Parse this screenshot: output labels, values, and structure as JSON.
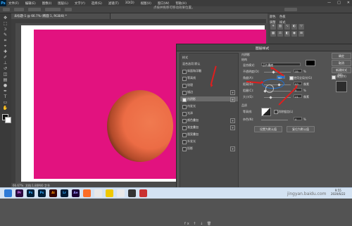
{
  "app": {
    "logo": "Ps",
    "window_controls": [
      "—",
      "□",
      "✕"
    ]
  },
  "menubar": {
    "items": [
      "文件(F)",
      "编辑(E)",
      "图像(I)",
      "图层(L)",
      "文字(Y)",
      "选择(S)",
      "滤镜(T)",
      "3D(D)",
      "视图(V)",
      "窗口(W)",
      "帮助(H)"
    ]
  },
  "title_hint": "点按并拖移可移动效果位置。",
  "doc_tab": {
    "label": "未标题-1 @ 66.7% (椭圆 1, RGB/8) *"
  },
  "toolbar": {
    "tools": [
      "move-tool",
      "marquee-tool",
      "lasso-tool",
      "quick-select-tool",
      "crop-tool",
      "eyedropper-tool",
      "healing-tool",
      "brush-tool",
      "stamp-tool",
      "history-brush-tool",
      "eraser-tool",
      "gradient-tool",
      "blur-tool",
      "dodge-tool",
      "pen-tool",
      "type-tool",
      "path-select-tool",
      "shape-tool",
      "hand-tool",
      "zoom-tool"
    ],
    "fg_color": "#111111",
    "bg_color": "#ffffff"
  },
  "canvas": {
    "bg": "#e2127f",
    "sphere_color": "#ec6c45"
  },
  "statusbar": {
    "zoom": "66.67%",
    "doc_info": "文档:1.80M/0 字节"
  },
  "right_panels": {
    "tabs": [
      "颜色",
      "色板"
    ],
    "tabs2": [
      "调整",
      "样式"
    ],
    "tab3": "图层"
  },
  "dialog": {
    "title": "图层样式",
    "styles_header": "样式",
    "blend_options": "混合选项:默认",
    "style_items": [
      {
        "label": "斜面和浮雕",
        "checked": false,
        "plus": false,
        "active": false
      },
      {
        "label": "等高线",
        "checked": false,
        "plus": false,
        "active": false
      },
      {
        "label": "纹理",
        "checked": false,
        "plus": false,
        "active": false
      },
      {
        "label": "描边",
        "checked": false,
        "plus": true,
        "active": false
      },
      {
        "label": "内阴影",
        "checked": true,
        "plus": true,
        "active": true
      },
      {
        "label": "内发光",
        "checked": false,
        "plus": false,
        "active": false
      },
      {
        "label": "光泽",
        "checked": false,
        "plus": false,
        "active": false
      },
      {
        "label": "颜色叠加",
        "checked": false,
        "plus": true,
        "active": false
      },
      {
        "label": "渐变叠加",
        "checked": false,
        "plus": true,
        "active": false
      },
      {
        "label": "图案叠加",
        "checked": false,
        "plus": false,
        "active": false
      },
      {
        "label": "外发光",
        "checked": false,
        "plus": false,
        "active": false
      },
      {
        "label": "投影",
        "checked": false,
        "plus": true,
        "active": false
      }
    ],
    "footer": "fx ↑ ↓ 🗑",
    "section_title": "内阴影",
    "structure": "结构",
    "blend_mode_label": "混合模式:",
    "blend_mode_value": "正片叠底",
    "opacity_label": "不透明度(O):",
    "opacity_value": "35",
    "percent": "%",
    "angle_label": "角度(A):",
    "angle_value": "90",
    "global_light": "使用全局光(G)",
    "distance_label": "距离(D):",
    "distance_value": "53",
    "choke_label": "阻塞(C):",
    "choke_value": "0",
    "size_label": "大小(S):",
    "size_value": "21",
    "px": "像素",
    "quality": "品质",
    "contour_label": "等高线:",
    "anti_alias": "消除锯齿(L)",
    "noise_label": "杂色(N):",
    "noise_value": "0",
    "btn_default": "设置为默认值",
    "btn_reset": "复位为默认值",
    "shadow_color": "#000000",
    "right_buttons": [
      "确定",
      "取消",
      "新建样式(W)...",
      "预览(V)"
    ]
  },
  "taskbar": {
    "icons": [
      {
        "label": "",
        "color": "#2d7ad6",
        "fg": "#ffffff"
      },
      {
        "label": "Pr",
        "color": "#2a0a3f",
        "fg": "#e77cff"
      },
      {
        "label": "Ps",
        "color": "#001e36",
        "fg": "#31a8ff"
      },
      {
        "label": "Ps",
        "color": "#001e36",
        "fg": "#31a8ff"
      },
      {
        "label": "Ai",
        "color": "#330000",
        "fg": "#ff9a00"
      },
      {
        "label": "Lr",
        "color": "#001a33",
        "fg": "#31a8ff"
      },
      {
        "label": "Ae",
        "color": "#1a0033",
        "fg": "#9999ff"
      },
      {
        "label": "",
        "color": "#fc6d26",
        "fg": "#ffffff"
      },
      {
        "label": "",
        "color": "#e8e8e8",
        "fg": "#1ca84a"
      },
      {
        "label": "",
        "color": "#f0c800",
        "fg": "#222222"
      },
      {
        "label": "",
        "color": "#e9e9e9",
        "fg": "#2d7ad6"
      },
      {
        "label": "",
        "color": "#333333",
        "fg": "#ffffff"
      },
      {
        "label": "",
        "color": "#c93030",
        "fg": "#ffffff"
      }
    ],
    "clock_time": "9:55",
    "clock_date": "2020/6/22"
  },
  "watermark": "jingyan.baidu.com"
}
